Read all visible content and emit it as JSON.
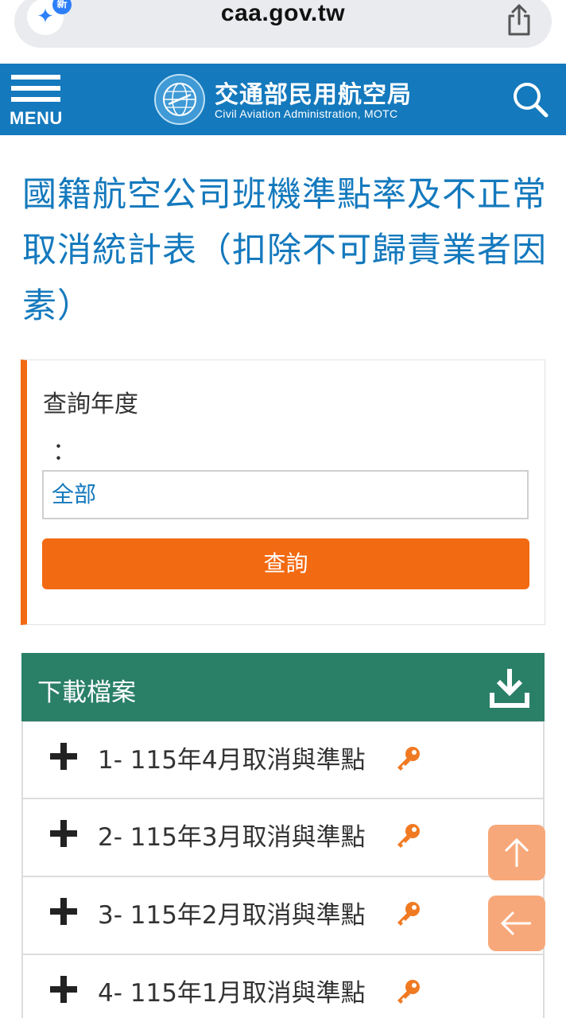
{
  "browser": {
    "url": "caa.gov.tw",
    "new_badge": "新",
    "sparkle_icon": "sparkle-icon",
    "share_icon": "share-icon"
  },
  "header": {
    "menu_label": "MENU",
    "org_name_zh": "交通部民用航空局",
    "org_name_en": "Civil Aviation Administration, MOTC",
    "search_icon": "search-icon",
    "color": "#1479bd"
  },
  "page": {
    "title": "國籍航空公司班機準點率及不正常取消統計表（扣除不可歸責業者因素）"
  },
  "query": {
    "label": "查詢年度",
    "colon": "：",
    "selected_year": "全部",
    "button_label": "查詢",
    "accent_color": "#f26a12"
  },
  "downloads": {
    "header": "下載檔案",
    "header_color": "#2a7f67",
    "items": [
      {
        "label": "1- 115年4月取消與準點"
      },
      {
        "label": "2- 115年3月取消與準點"
      },
      {
        "label": "3- 115年2月取消與準點"
      },
      {
        "label": "4- 115年1月取消與準點"
      }
    ]
  },
  "floating": {
    "top_icon": "arrow-up-icon",
    "back_icon": "arrow-left-icon"
  }
}
